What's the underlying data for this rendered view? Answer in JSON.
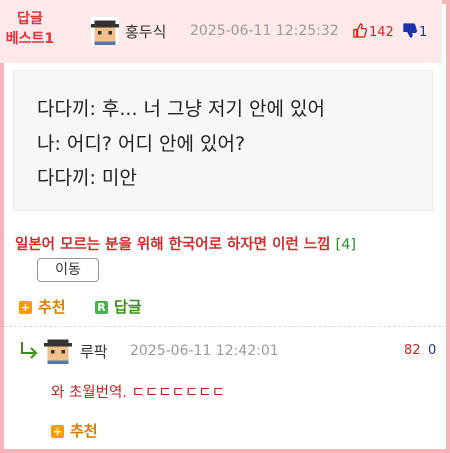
{
  "post": {
    "badge_line1": "답글",
    "badge_line2": "베스트1",
    "nickname": "홍두식",
    "date": "2025-06-11 12:25:32",
    "upvotes": "142",
    "downvotes": "1",
    "quote_lines": [
      "다다끼: 후... 너 그냥 저기 안에 있어",
      "나: 어디? 어디 안에 있어?",
      "다다끼: 미안"
    ],
    "comment": "일본어 모르는 분을 위해 한국어로 하자면 이런 느낌",
    "comment_count": "[4]",
    "move_button": "이동",
    "recommend_label": "추천",
    "reply_label": "답글",
    "reply_badge_letter": "R",
    "plus_badge": "+"
  },
  "reply": {
    "nickname": "루팍",
    "date": "2025-06-11 12:42:01",
    "upvotes": "82",
    "downvotes": "0",
    "text": "와 초월번역. ㄷㄷㄷㄷㄷㄷㄷ",
    "recommend_label": "추천",
    "plus_badge": "+"
  },
  "colors": {
    "border": "#f6b3b8",
    "header_bg": "#fde9ea",
    "best_badge": "#e1313f",
    "up": "#e02020",
    "down": "#1d30a8",
    "recommend": "#d08000",
    "reply_green": "#3b8d1d"
  },
  "icons": [
    "thumbs-up-icon",
    "thumbs-down-icon",
    "avatar-icon",
    "reply-arrow-icon",
    "plus-square-icon",
    "reply-badge-icon"
  ]
}
